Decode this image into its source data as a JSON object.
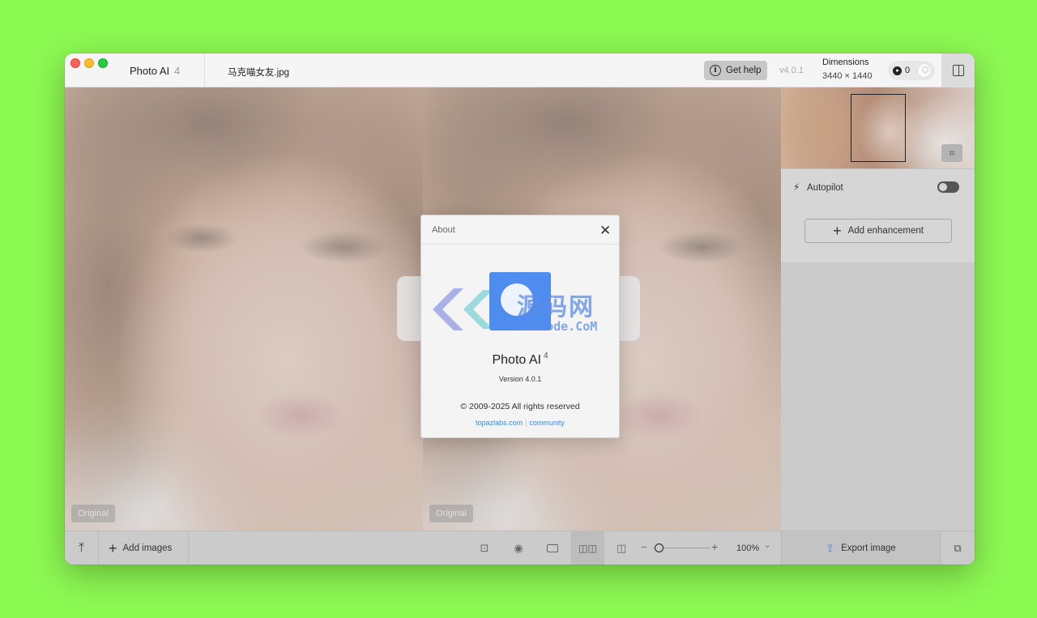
{
  "titlebar": {
    "app_name": "Photo AI",
    "app_major": "4",
    "filename": "马克喵女友.jpg",
    "get_help": "Get help",
    "version": "v4.0.1",
    "dimensions_label": "Dimensions",
    "dimensions_value": "3440 × 1440",
    "credits": "0"
  },
  "panes": {
    "left_tag": "Original",
    "right_tag": "Original"
  },
  "sidebar": {
    "autopilot_label": "Autopilot",
    "autopilot_enabled": false,
    "add_enhancement": "Add enhancement"
  },
  "bottombar": {
    "add_images": "Add images",
    "zoom": "100%",
    "zoom_level_fraction": 0.05,
    "export": "Export image"
  },
  "dialog": {
    "title": "About",
    "app_name": "Photo AI",
    "app_major": "4",
    "version_line": "Version 4.0.1",
    "copyright": "© 2009-2025 All rights reserved",
    "link_site": "topazlabs.com",
    "link_separator": "|",
    "link_community": "community"
  },
  "watermark": {
    "text": "源码网",
    "sub": "52Scode.CoM"
  },
  "icons": {
    "help": "info-icon",
    "credits": "coin-icon",
    "panel": "panel-toggle-icon",
    "crop": "crop-icon",
    "autopilot": "bolt-icon",
    "upload": "upload-icon",
    "export": "share-icon"
  },
  "colors": {
    "background": "#8cf852",
    "accent": "#3d8ce0",
    "traffic_red": "#fe5f57",
    "traffic_yellow": "#febc2e",
    "traffic_green": "#28c840"
  }
}
